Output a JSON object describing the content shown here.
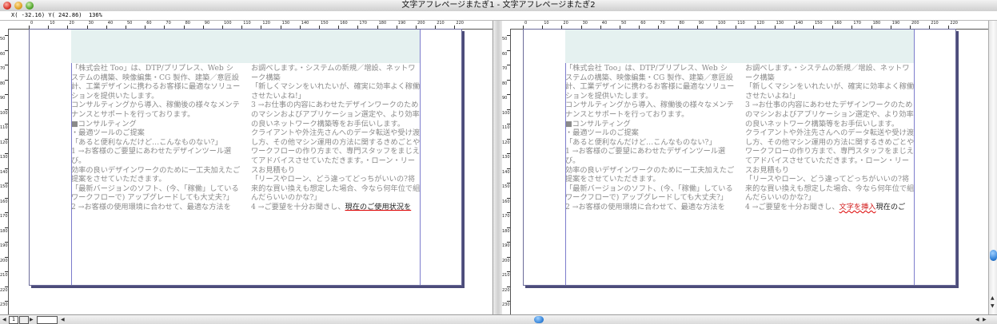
{
  "window": {
    "title": "文字アフレページまたぎ1 - 文字アフレページまたぎ2"
  },
  "coordbar": {
    "x": "X( -32.16)",
    "y": "Y( 242.86)",
    "zoom": "136%"
  },
  "ruler": {
    "h_labels": [
      "0",
      "10",
      "20",
      "30",
      "40",
      "50",
      "60",
      "70",
      "80",
      "90",
      "100",
      "110",
      "120",
      "130",
      "140",
      "150",
      "160",
      "170",
      "180",
      "190",
      "200",
      "210",
      "220"
    ],
    "v_labels": [
      "50",
      "60",
      "70",
      "80",
      "90",
      "100",
      "110",
      "120",
      "130",
      "140",
      "150",
      "160",
      "170",
      "180",
      "190",
      "200",
      "210",
      "220",
      "230"
    ]
  },
  "document": {
    "left": {
      "col1": [
        "「株式会社 Too」は、DTP/プリプレス、Web システムの構築、映像編集・CG 製作、建築／意匠設計、工業デザインに携わるお客様に最適なソリューションを提供いたします。",
        "コンサルティングから導入、稼働後の様々なメンテナンスとサポートを行っております。",
        "■コンサルティング",
        "・最適ツールのご提案",
        "「あると便利なんだけど…こんなものない?」",
        "1 →お客様のご要望にあわせたデザインツール選び。",
        "効率の良いデザインワークのために一工夫加えたご提案をさせていただきます。",
        "「最新バージョンのソフト、(今、「稼働」しているワークフローで) アップグレードしても大丈夫?」",
        "2 →お客様の使用環境に合わせて、最適な方法を"
      ],
      "col2": [
        "お調べします。・システムの新規／増設、ネットワーク構築",
        "「新しくマシンをいれたいが、確実に効率よく稼働させたいよね!」",
        "3 →お仕事の内容にあわせたデザインワークのためのマシンおよびアプリケーション選定や、より効率の良いネットワーク構築等をお手伝いします。",
        "クライアントや外注先さんへのデータ転送や受け渡し方、その他マシン運用の方法に関するきめごとやワークフローの作り方まで、専門スタッフをまじえてアドバイスさせていただきます。・ローン・リースお見積もり",
        "「リースやローン、どう違ってどっちがいいの?将来的な買い換えも想定した場合、今なら何年位で組んだらいいのかな?」"
      ],
      "col2_last_prefix": "4 →ご要望を十分お聞きし、",
      "col2_last_highlight": "現在のご使用状況を"
    },
    "right": {
      "col1": [
        "「株式会社 Too」は、DTP/プリプレス、Web システムの構築、映像編集・CG 製作、建築／意匠設計、工業デザインに携わるお客様に最適なソリューションを提供いたします。",
        "コンサルティングから導入、稼働後の様々なメンテナンスとサポートを行っております。",
        "■コンサルティング",
        "・最適ツールのご提案",
        "「あると便利なんだけど…こんなものない?」",
        "1 →お客様のご要望にあわせたデザインツール選び。",
        "効率の良いデザインワークのために一工夫加えたご提案をさせていただきます。",
        "「最新バージョンのソフト、(今、「稼働」しているワークフローで) アップグレードしても大丈夫?」",
        "2 →お客様の使用環境に合わせて、最適な方法を"
      ],
      "col2": [
        "お調べします。・システムの新規／増設、ネットワーク構築",
        "「新しくマシンをいれたいが、確実に効率よく稼働させたいよね!」",
        "3 →お仕事の内容にあわせたデザインワークのためのマシンおよびアプリケーション選定や、より効率の良いネットワーク構築等をお手伝いします。",
        "クライアントや外注先さんへのデータ転送や受け渡し方、その他マシン運用の方法に関するきめごとやワークフローの作り方まで、専門スタッフをまじえてアドバイスさせていただきます。・ローン・リースお見積もり",
        "「リースやローン、どう違ってどっちがいいの?将来的な買い換えも想定した場合、今なら何年位で組んだらいいのかな?」"
      ],
      "col2_last_prefix": "4 →ご要望を十分お聞きし、",
      "col2_last_inserted": "文字を挿入",
      "col2_last_suffix": "現在のご"
    }
  },
  "bottombar": {
    "page_number": "1"
  },
  "colors": {
    "header_box": "#e5f1f0",
    "body_text": "#8a8a8a",
    "inserted_text": "#d21a1a",
    "scroll_thumb": "#2f7fd6"
  }
}
